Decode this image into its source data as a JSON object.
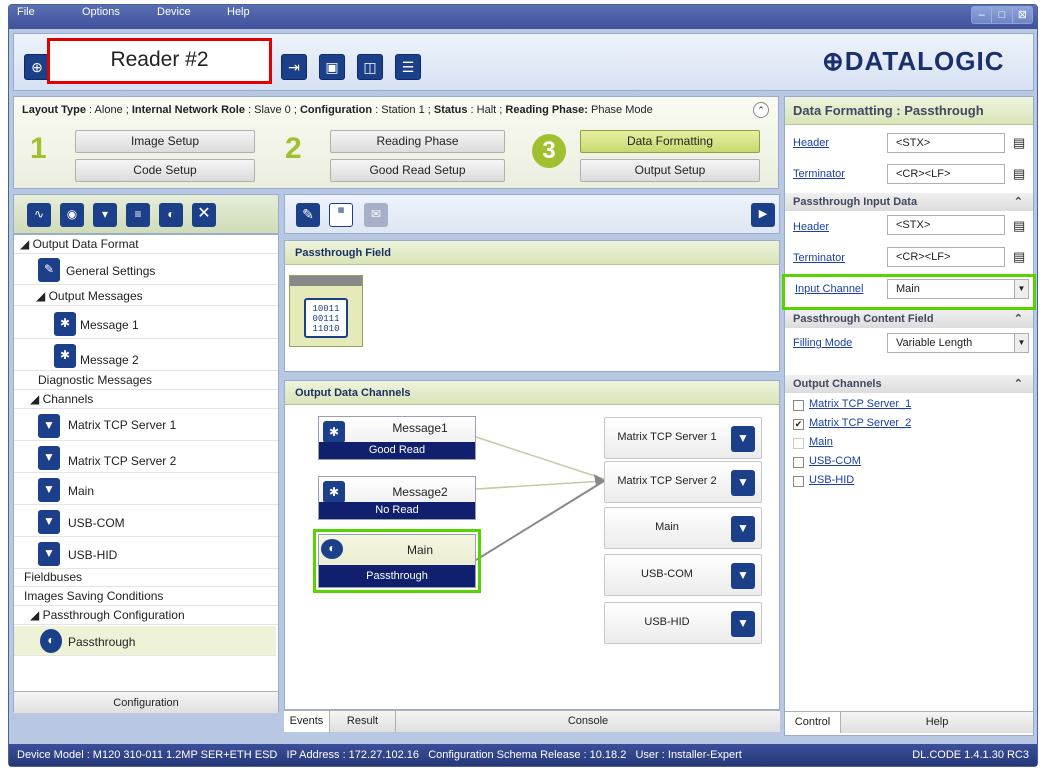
{
  "menu": [
    "File",
    "Options",
    "Device",
    "Help"
  ],
  "window_buttons": [
    "–",
    "□",
    "⊠"
  ],
  "reader_name": "Reader #2",
  "logo": "⊕DATALOGIC",
  "info": {
    "layout_type_label": "Layout Type",
    "layout_type": "Alone",
    "network_role_label": "Internal Network Role",
    "network_role": "Slave 0",
    "configuration_label": "Configuration",
    "configuration": "Station 1",
    "status_label": "Status",
    "status": "Halt",
    "reading_phase_label": "Reading Phase:",
    "reading_phase": "Phase Mode"
  },
  "steps": {
    "n1": "1",
    "n2": "2",
    "n3": "3",
    "image_setup": "Image Setup",
    "code_setup": "Code Setup",
    "reading_phase": "Reading Phase",
    "good_read_setup": "Good Read Setup",
    "data_formatting": "Data Formatting",
    "output_setup": "Output Setup"
  },
  "tree": {
    "output_data_format": "Output Data Format",
    "general_settings": "General Settings",
    "output_messages": "Output Messages",
    "message1": "Message 1",
    "message2": "Message 2",
    "diagnostic_messages": "Diagnostic Messages",
    "channels": "Channels",
    "mtcp1": "Matrix TCP Server 1",
    "mtcp2": "Matrix TCP Server 2",
    "main": "Main",
    "usbcom": "USB-COM",
    "usbhid": "USB-HID",
    "fieldbuses": "Fieldbuses",
    "images_saving": "Images Saving Conditions",
    "passthrough_config": "Passthrough Configuration",
    "passthrough": "Passthrough"
  },
  "left_tab": "Configuration",
  "mid": {
    "passthrough_field": "Passthrough Field",
    "binary": "10011\n00111\n11010",
    "output_channels": "Output Data Channels",
    "msg1": "Message1",
    "msg1_state": "Good Read",
    "msg2": "Message2",
    "msg2_state": "No Read",
    "main": "Main",
    "main_state": "Passthrough",
    "ch": [
      "Matrix TCP Server 1",
      "Matrix TCP Server 2",
      "Main",
      "USB-COM",
      "USB-HID"
    ],
    "tabs": [
      "Events",
      "Result",
      "Console"
    ]
  },
  "right": {
    "title": "Data Formatting : Passthrough",
    "header": "Header",
    "header_val": "<STX>",
    "terminator": "Terminator",
    "terminator_val": "<CR><LF>",
    "pt_input": "Passthrough Input Data",
    "header2": "Header",
    "header2_val": "<STX>",
    "terminator2": "Terminator",
    "terminator2_val": "<CR><LF>",
    "input_channel": "Input Channel",
    "input_channel_val": "Main",
    "pt_content": "Passthrough Content Field",
    "filling_mode": "Filling Mode",
    "filling_mode_val": "Variable Length",
    "out_channels": "Output Channels",
    "oc": [
      "Matrix TCP Server_1",
      "Matrix TCP Server_2",
      "Main",
      "USB-COM",
      "USB-HID"
    ],
    "oc_checked": [
      false,
      true,
      false,
      false,
      false
    ],
    "tabs": [
      "Control",
      "Help"
    ]
  },
  "status_bar": {
    "left": "Device Model : M120 310-011 1.2MP SER+ETH ESD   IP Address : 172.27.102.16   Configuration Schema Release : 10.18.2   User : Installer-Expert",
    "right": "DL.CODE 1.4.1.30 RC3"
  }
}
